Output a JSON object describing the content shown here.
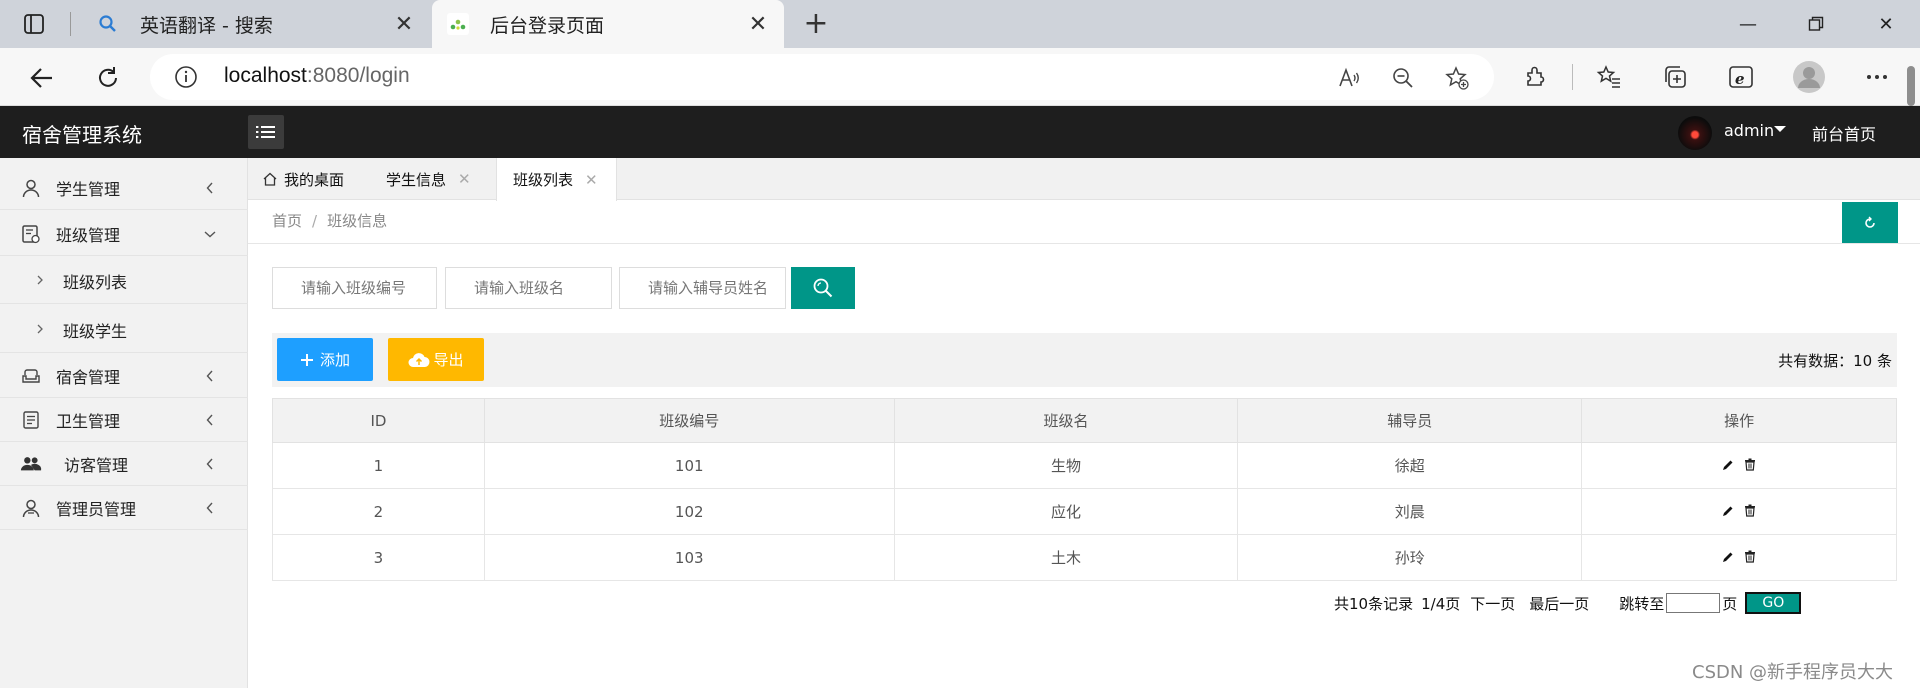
{
  "browser": {
    "tabs": [
      {
        "title": "英语翻译 - 搜索",
        "icon": "search-icon"
      },
      {
        "title": "后台登录页面",
        "icon": "site-icon"
      }
    ],
    "url_host": "localhost",
    "url_rest": ":8080/login"
  },
  "header": {
    "app_title": "宿舍管理系统",
    "user_name": "admin",
    "front_link": "前台首页"
  },
  "sidebar": {
    "items": [
      {
        "label": "学生管理",
        "icon": "user-icon",
        "expanded": false
      },
      {
        "label": "班级管理",
        "icon": "class-icon",
        "expanded": true
      },
      {
        "label": "班级列表",
        "sub": true
      },
      {
        "label": "班级学生",
        "sub": true
      },
      {
        "label": "宿舍管理",
        "icon": "sofa-icon",
        "expanded": false
      },
      {
        "label": "卫生管理",
        "icon": "clipboard-icon",
        "expanded": false
      },
      {
        "label": "访客管理",
        "icon": "users-icon",
        "expanded": false
      },
      {
        "label": "管理员管理",
        "icon": "admin-icon",
        "expanded": false
      }
    ]
  },
  "content_tabs": [
    {
      "label": "我的桌面"
    },
    {
      "label": "学生信息"
    },
    {
      "label": "班级列表"
    }
  ],
  "breadcrumb": {
    "home": "首页",
    "current": "班级信息"
  },
  "search": {
    "class_no_placeholder": "请输入班级编号",
    "class_name_placeholder": "请输入班级名",
    "counselor_placeholder": "请输入辅导员姓名"
  },
  "toolbar": {
    "add_label": "添加",
    "export_label": "导出",
    "total_text": "共有数据：10 条"
  },
  "table": {
    "headers": [
      "ID",
      "班级编号",
      "班级名",
      "辅导员",
      "操作"
    ],
    "rows": [
      [
        "1",
        "101",
        "生物",
        "徐超"
      ],
      [
        "2",
        "102",
        "应化",
        "刘晨"
      ],
      [
        "3",
        "103",
        "土木",
        "孙玲"
      ]
    ]
  },
  "pager": {
    "records": "共10条记录",
    "pages": "1/4页",
    "next": "下一页",
    "last": "最后一页",
    "jump_label": "跳转至",
    "page_suffix": "页",
    "go_label": "GO"
  },
  "watermark": "CSDN @新手程序员大大",
  "colors": {
    "primary": "#009688",
    "blue": "#1e9fff",
    "orange": "#ffb800",
    "header_bg": "#1e1e1e"
  }
}
